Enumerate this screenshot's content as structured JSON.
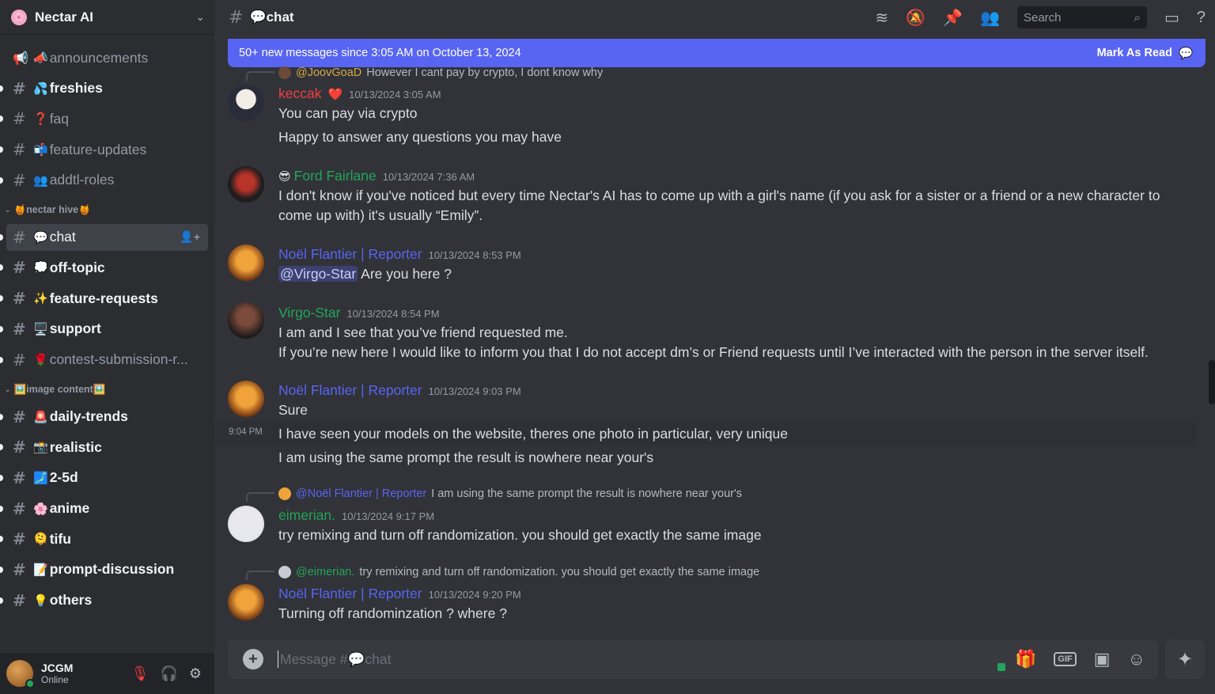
{
  "server": {
    "name": "Nectar AI",
    "logo": "🌸"
  },
  "channels_top": [
    {
      "emoji": "📣",
      "name": "announcements",
      "icon": "megaphone-icon"
    },
    {
      "emoji": "💦",
      "name": "freshies",
      "bright": true
    },
    {
      "emoji": "❓",
      "name": "faq"
    },
    {
      "emoji": "📬",
      "name": "feature-updates"
    },
    {
      "emoji": "👥",
      "name": "addtl-roles"
    }
  ],
  "category_hive": "🍯nectar hive🍯",
  "channels_hive": [
    {
      "emoji": "💬",
      "name": "chat",
      "active": true
    },
    {
      "emoji": "💭",
      "name": "off-topic",
      "bright": true
    },
    {
      "emoji": "✨",
      "name": "feature-requests",
      "bright": true
    },
    {
      "emoji": "🖥️",
      "name": "support",
      "bright": true
    },
    {
      "emoji": "🌹",
      "name": "contest-submission-r..."
    }
  ],
  "category_image": "🖼️image content🖼️",
  "channels_image": [
    {
      "emoji": "🚨",
      "name": "daily-trends",
      "bright": true
    },
    {
      "emoji": "📸",
      "name": "realistic",
      "bright": true
    },
    {
      "emoji": "🗾",
      "name": "2-5d",
      "bright": true
    },
    {
      "emoji": "🌸",
      "name": "anime",
      "bright": true
    },
    {
      "emoji": "🫠",
      "name": "tifu",
      "bright": true
    },
    {
      "emoji": "📝",
      "name": "prompt-discussion",
      "bright": true
    },
    {
      "emoji": "💡",
      "name": "others",
      "bright": true
    }
  ],
  "user": {
    "name": "JCGM",
    "status": "Online"
  },
  "topbar": {
    "channel": "💬chat",
    "search_placeholder": "Search"
  },
  "newbar": {
    "text": "50+ new messages since 3:05 AM on October 13, 2024",
    "action": "Mark As Read"
  },
  "messages": {
    "r1_name": "@JoovGoaD",
    "r1_text": "However I cant pay by crypto, I dont know why",
    "m1_author": "keccak",
    "m1_badge": "❤️",
    "m1_ts": "10/13/2024 3:05 AM",
    "m1_l1": "You can pay via crypto",
    "m1_l2": "Happy to answer any questions you may have",
    "m2_emoji": "😎",
    "m2_author": "Ford Fairlane",
    "m2_ts": "10/13/2024 7:36 AM",
    "m2_l1": "I don't know if you've noticed but every time Nectar's AI has to come up with a girl's name (if you ask for a sister or a friend or a new character to",
    "m2_l2": "come up with) it's usually “Emily”.",
    "m3_author": "Noël Flantier | Reporter",
    "m3_ts": "10/13/2024 8:53 PM",
    "m3_mention": "@Virgo-Star",
    "m3_text": "Are you here ?",
    "m4_author": "Virgo-Star",
    "m4_ts": "10/13/2024 8:54 PM",
    "m4_l1": "I am and I see that you’ve friend requested me.",
    "m4_l2": "If you’re new here I would like to inform you that I do not accept dm’s or Friend requests until I’ve interacted with the person in the server itself.",
    "m5_author": "Noël Flantier | Reporter",
    "m5_ts": "10/13/2024 9:03 PM",
    "m5_l1": "Sure",
    "m5_hover": "9:04 PM",
    "m5_l2": "I have seen your models on the website, theres one photo in particular, very unique",
    "m5_l3": "I am using the same prompt the result is nowhere near your's",
    "r2_name": "@Noël Flantier | Reporter",
    "r2_text": "I am using the same prompt the result is nowhere near your's",
    "m6_author": "eimerian.",
    "m6_ts": "10/13/2024 9:17 PM",
    "m6_l1": "try remixing and turn off randomization. you should get exactly the same image",
    "r3_name": "@eimerian.",
    "r3_text": "try remixing and turn off randomization. you should get exactly the same image",
    "m7_author": "Noël Flantier | Reporter",
    "m7_ts": "10/13/2024 9:20 PM",
    "m7_l1": "Turning off randominzation ? where ?"
  },
  "composer": {
    "placeholder": "Message #💬chat"
  },
  "colors": {
    "keccak": "#f23f42",
    "ford": "#23a55a",
    "noel": "#5865f2",
    "virgo": "#23a55a",
    "eimerian": "#23a55a",
    "reply_joov": "#d4a94a"
  }
}
